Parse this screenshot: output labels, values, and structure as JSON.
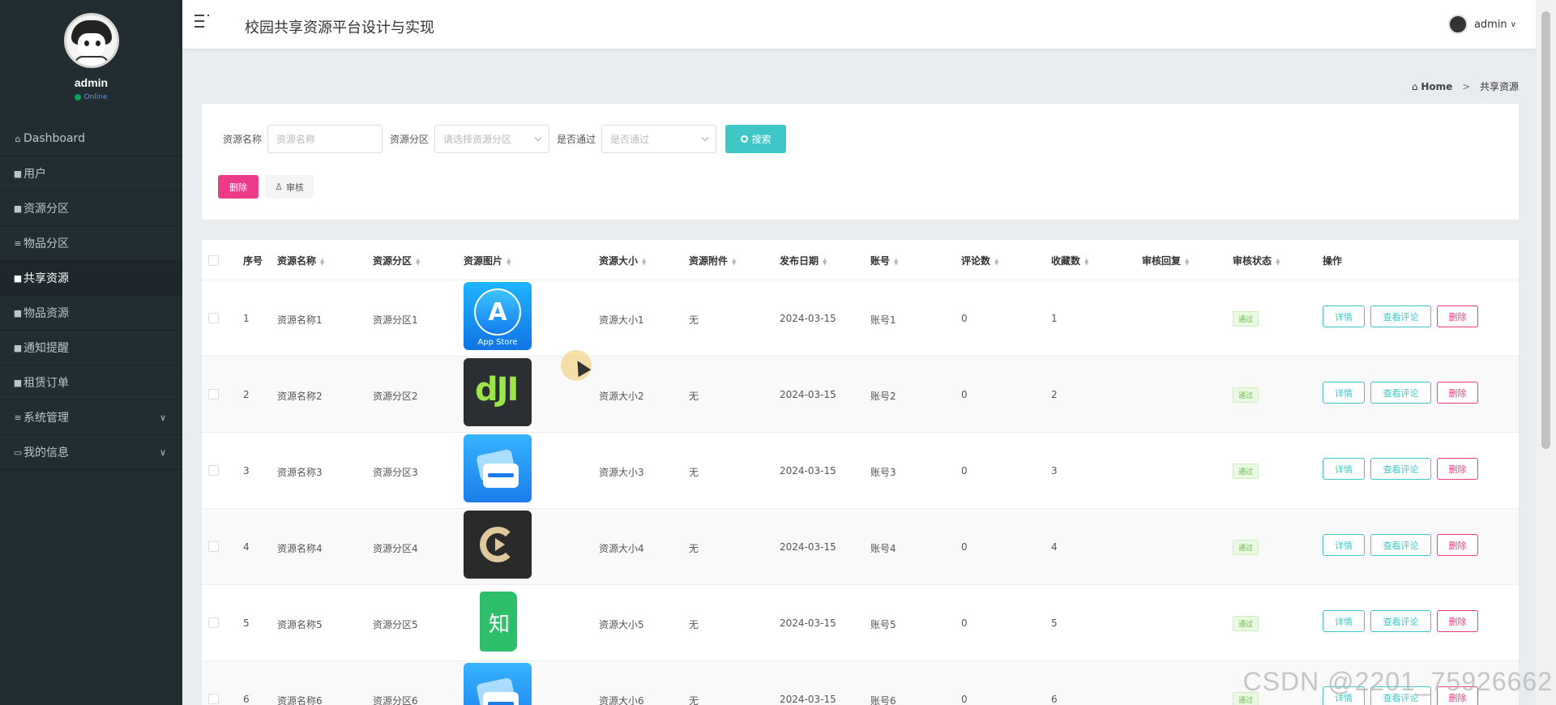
{
  "sidebar": {
    "username": "admin",
    "status": "Online",
    "items": [
      {
        "icon": "⌂",
        "label": "Dashboard"
      },
      {
        "icon": "■",
        "label": "用户"
      },
      {
        "icon": "■",
        "label": "资源分区"
      },
      {
        "icon": "≡",
        "label": "物品分区"
      },
      {
        "icon": "■",
        "label": "共享资源"
      },
      {
        "icon": "■",
        "label": "物品资源"
      },
      {
        "icon": "■",
        "label": "通知提醒"
      },
      {
        "icon": "■",
        "label": "租赁订单"
      },
      {
        "icon": "≡",
        "label": "系统管理"
      },
      {
        "icon": "▭",
        "label": "我的信息"
      }
    ]
  },
  "header": {
    "title": "校园共享资源平台设计与实现",
    "user": "admin"
  },
  "breadcrumb": {
    "home": "Home",
    "current": "共享资源"
  },
  "search": {
    "name_label": "资源名称",
    "name_placeholder": "资源名称",
    "zone_label": "资源分区",
    "zone_placeholder": "请选择资源分区",
    "pass_label": "是否通过",
    "pass_placeholder": "是否通过",
    "button": "搜索"
  },
  "actions": {
    "delete": "删除",
    "audit": "审核"
  },
  "table": {
    "headers": [
      "序号",
      "资源名称",
      "资源分区",
      "资源图片",
      "资源大小",
      "资源附件",
      "发布日期",
      "账号",
      "评论数",
      "收藏数",
      "审核回复",
      "审核状态",
      "操作"
    ],
    "ops": {
      "detail": "详情",
      "comments": "查看评论",
      "delete": "删除"
    },
    "rows": [
      {
        "index": "1",
        "name": "资源名称1",
        "zone": "资源分区1",
        "icon": "app-store-icon",
        "size": "资源大小1",
        "attach": "无",
        "date": "2024-03-15",
        "account": "账号1",
        "comments": "0",
        "favorites": "1",
        "reply": "",
        "status": "通过"
      },
      {
        "index": "2",
        "name": "资源名称2",
        "zone": "资源分区2",
        "icon": "dji-icon",
        "size": "资源大小2",
        "attach": "无",
        "date": "2024-03-15",
        "account": "账号2",
        "comments": "0",
        "favorites": "2",
        "reply": "",
        "status": "通过"
      },
      {
        "index": "3",
        "name": "资源名称3",
        "zone": "资源分区3",
        "icon": "card-wallet-icon",
        "size": "资源大小3",
        "attach": "无",
        "date": "2024-03-15",
        "account": "账号3",
        "comments": "0",
        "favorites": "3",
        "reply": "",
        "status": "通过"
      },
      {
        "index": "4",
        "name": "资源名称4",
        "zone": "资源分区4",
        "icon": "video-player-icon",
        "size": "资源大小4",
        "attach": "无",
        "date": "2024-03-15",
        "account": "账号4",
        "comments": "0",
        "favorites": "4",
        "reply": "",
        "status": "通过"
      },
      {
        "index": "5",
        "name": "资源名称5",
        "zone": "资源分区5",
        "icon": "zhihu-book-icon",
        "size": "资源大小5",
        "attach": "无",
        "date": "2024-03-15",
        "account": "账号5",
        "comments": "0",
        "favorites": "5",
        "reply": "",
        "status": "通过"
      },
      {
        "index": "6",
        "name": "资源名称6",
        "zone": "资源分区6",
        "icon": "card-wallet-icon",
        "size": "资源大小6",
        "attach": "无",
        "date": "2024-03-15",
        "account": "账号6",
        "comments": "0",
        "favorites": "6",
        "reply": "",
        "status": "通过"
      }
    ]
  },
  "appstore_caption": "App Store",
  "dji_text": "dJI",
  "zhi_text": "知",
  "watermark": "CSDN @2201_75926662",
  "colors": {
    "sidebar": "#222d32",
    "accent": "#3fc7c7",
    "danger": "#ec3a86",
    "success": "#67c23a"
  }
}
